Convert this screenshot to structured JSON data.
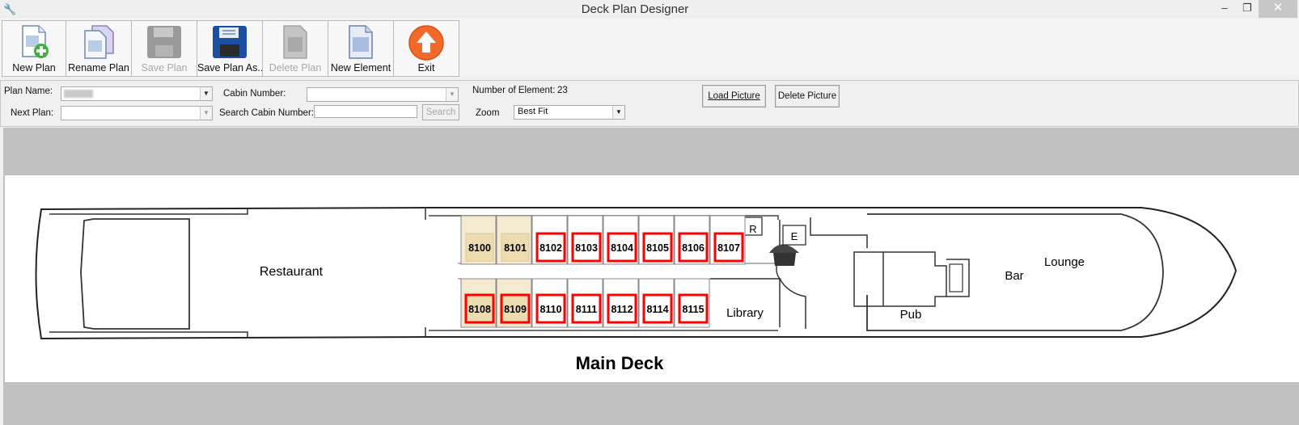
{
  "window": {
    "title": "Deck Plan Designer"
  },
  "toolbar": {
    "new_plan": "New Plan",
    "rename_plan": "Rename Plan",
    "save_plan": "Save Plan",
    "save_plan_as": "Save Plan As..",
    "delete_plan": "Delete Plan",
    "new_element": "New Element",
    "exit": "Exit"
  },
  "form": {
    "plan_name_label": "Plan Name:",
    "plan_name_value": "",
    "next_plan_label": "Next Plan:",
    "next_plan_value": "",
    "cabin_number_label": "Cabin Number:",
    "cabin_number_value": "",
    "search_cabin_label": "Search Cabin Number:",
    "search_cabin_value": "",
    "search_button": "Search",
    "element_count_label": "Number of Element:",
    "element_count": "23",
    "zoom_label": "Zoom",
    "zoom_value": "Best Fit",
    "load_picture": "Load Picture",
    "delete_picture": "Delete Picture"
  },
  "plan": {
    "title": "Main Deck",
    "labels": {
      "restaurant": "Restaurant",
      "library": "Library",
      "pub": "Pub",
      "bar": "Bar",
      "lounge": "Lounge",
      "r": "R",
      "e": "E"
    },
    "top_cabins": [
      "8100",
      "8101",
      "8102",
      "8103",
      "8104",
      "8105",
      "8106",
      "8107"
    ],
    "bottom_cabins": [
      "8108",
      "8109",
      "8110",
      "8111",
      "8112",
      "8114",
      "8115"
    ]
  },
  "colors": {
    "cabin_fill": "#ecdcaf",
    "selected_outline": "#ff0000",
    "canvas": "#c0c0c0"
  }
}
